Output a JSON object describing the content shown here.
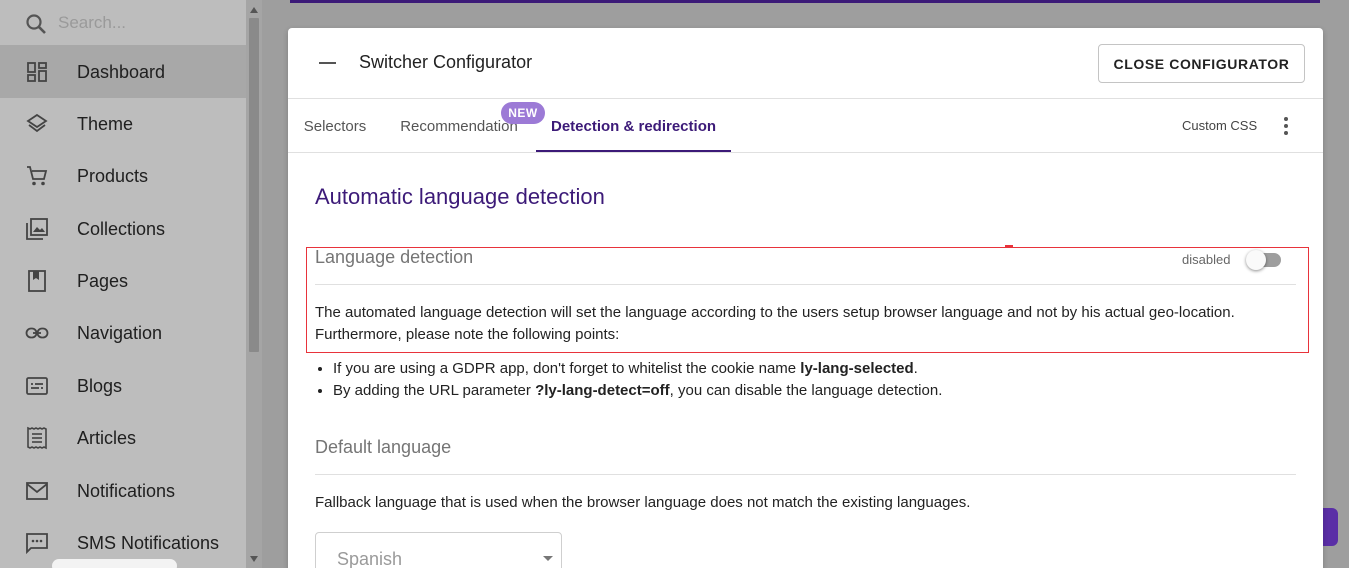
{
  "sidebar": {
    "search_placeholder": "Search...",
    "items": [
      {
        "label": "Dashboard",
        "icon": "dashboard-icon",
        "active": true
      },
      {
        "label": "Theme",
        "icon": "layers-icon"
      },
      {
        "label": "Products",
        "icon": "cart-icon"
      },
      {
        "label": "Collections",
        "icon": "image-collection-icon"
      },
      {
        "label": "Pages",
        "icon": "page-icon"
      },
      {
        "label": "Navigation",
        "icon": "link-icon"
      },
      {
        "label": "Blogs",
        "icon": "blog-icon"
      },
      {
        "label": "Articles",
        "icon": "article-icon"
      },
      {
        "label": "Notifications",
        "icon": "mail-icon"
      },
      {
        "label": "SMS Notifications",
        "icon": "sms-icon"
      }
    ]
  },
  "dialog": {
    "title": "Switcher Configurator",
    "close_label": "CLOSE CONFIGURATOR",
    "tabs": [
      {
        "label": "Selectors"
      },
      {
        "label": "Recommendation",
        "badge": "NEW"
      },
      {
        "label": "Detection & redirection",
        "active": true
      }
    ],
    "custom_css_label": "Custom CSS",
    "section_title": "Automatic language detection",
    "language_detection": {
      "title": "Language detection",
      "toggle_state_label": "disabled",
      "toggle_on": false,
      "description": "The automated language detection will set the language according to the users setup browser language and not by his actual geo-location. Furthermore, please note the following points:",
      "bullets": [
        {
          "before": "If you are using a GDPR app, don't forget to whitelist the cookie name ",
          "bold": "ly-lang-selected",
          "after": "."
        },
        {
          "before": "By adding the URL parameter ",
          "bold": "?ly-lang-detect=off",
          "after": ", you can disable the language detection."
        }
      ]
    },
    "default_language": {
      "title": "Default language",
      "description": "Fallback language that is used when the browser language does not match the existing languages.",
      "selected": "Spanish"
    }
  },
  "colors": {
    "accent": "#3c1a78",
    "badge": "#9c7ad6",
    "highlight": "#e8333b"
  }
}
